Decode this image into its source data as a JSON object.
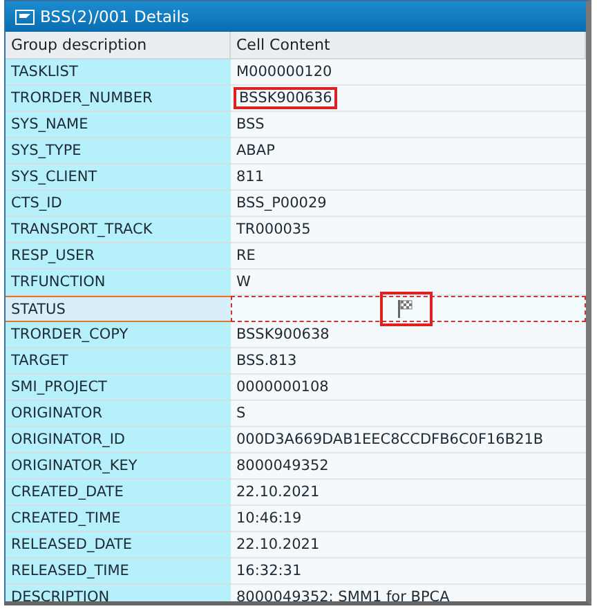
{
  "window": {
    "title": "BSS(2)/001 Details"
  },
  "table": {
    "columns": [
      "Group description",
      "Cell Content"
    ],
    "rows": [
      {
        "label": "TASKLIST",
        "kind": "text",
        "value": "M000000120",
        "selected": false,
        "highlighted": false
      },
      {
        "label": "TRORDER_NUMBER",
        "kind": "text",
        "value": "BSSK900636",
        "selected": false,
        "highlighted": true
      },
      {
        "label": "SYS_NAME",
        "kind": "text",
        "value": "BSS",
        "selected": false,
        "highlighted": false
      },
      {
        "label": "SYS_TYPE",
        "kind": "text",
        "value": "ABAP",
        "selected": false,
        "highlighted": false
      },
      {
        "label": "SYS_CLIENT",
        "kind": "text",
        "value": "811",
        "selected": false,
        "highlighted": false
      },
      {
        "label": "CTS_ID",
        "kind": "text",
        "value": "BSS_P00029",
        "selected": false,
        "highlighted": false
      },
      {
        "label": "TRANSPORT_TRACK",
        "kind": "text",
        "value": "TR000035",
        "selected": false,
        "highlighted": false
      },
      {
        "label": "RESP_USER",
        "kind": "text",
        "value": "RE",
        "selected": false,
        "highlighted": false
      },
      {
        "label": "TRFUNCTION",
        "kind": "text",
        "value": "W",
        "selected": false,
        "highlighted": false
      },
      {
        "label": "STATUS",
        "kind": "flag",
        "selected": true,
        "highlighted": true
      },
      {
        "label": "TRORDER_COPY",
        "kind": "text",
        "value": "BSSK900638",
        "selected": false,
        "highlighted": false
      },
      {
        "label": "TARGET",
        "kind": "text",
        "value": "BSS.813",
        "selected": false,
        "highlighted": false
      },
      {
        "label": "SMI_PROJECT",
        "kind": "text",
        "value": "0000000108",
        "selected": false,
        "highlighted": false
      },
      {
        "label": "ORIGINATOR",
        "kind": "text",
        "value": "S",
        "selected": false,
        "highlighted": false
      },
      {
        "label": "ORIGINATOR_ID",
        "kind": "text",
        "value": "000D3A669DAB1EEC8CCDFB6C0F16B21B",
        "selected": false,
        "highlighted": false
      },
      {
        "label": "ORIGINATOR_KEY",
        "kind": "text",
        "value": "8000049352",
        "selected": false,
        "highlighted": false
      },
      {
        "label": "CREATED_DATE",
        "kind": "text",
        "value": "22.10.2021",
        "selected": false,
        "highlighted": false
      },
      {
        "label": "CREATED_TIME",
        "kind": "text",
        "value": "10:46:19",
        "selected": false,
        "highlighted": false
      },
      {
        "label": "RELEASED_DATE",
        "kind": "text",
        "value": "22.10.2021",
        "selected": false,
        "highlighted": false
      },
      {
        "label": "RELEASED_TIME",
        "kind": "text",
        "value": "16:32:31",
        "selected": false,
        "highlighted": false
      },
      {
        "label": "DESCRIPTION",
        "kind": "text",
        "value": "8000049352: SMM1 for BPCA",
        "selected": false,
        "highlighted": false
      }
    ]
  }
}
